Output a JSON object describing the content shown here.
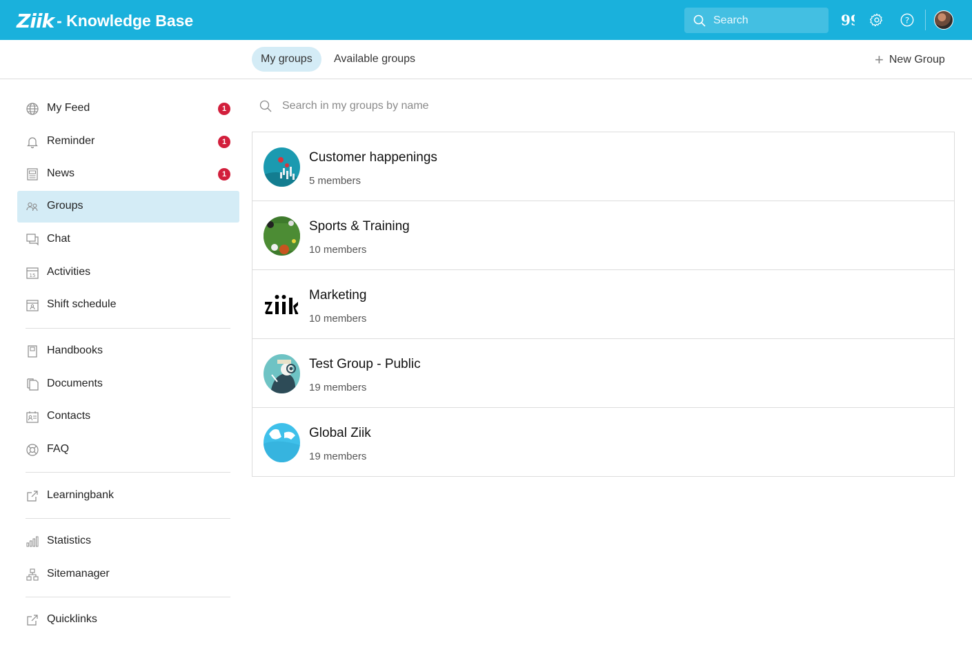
{
  "header": {
    "logo": "Ziik",
    "title": "- Knowledge Base",
    "search_placeholder": "Search",
    "icons": [
      "quote-icon",
      "gear-icon",
      "help-icon"
    ],
    "colors": {
      "topbar": "#1ab1dc",
      "active_bg": "#d4ecf6",
      "badge": "#d21f3c"
    }
  },
  "tabs": [
    {
      "label": "My groups",
      "active": true
    },
    {
      "label": "Available groups",
      "active": false
    }
  ],
  "new_group_label": "New Group",
  "sidebar": {
    "items": [
      {
        "label": "My Feed",
        "badge": "1",
        "icon": "globe-icon"
      },
      {
        "label": "Reminder",
        "badge": "1",
        "icon": "bell-icon"
      },
      {
        "label": "News",
        "badge": "1",
        "icon": "newspaper-icon"
      },
      {
        "label": "Groups",
        "active": true,
        "icon": "users-icon"
      },
      {
        "label": "Chat",
        "icon": "chat-icon"
      },
      {
        "label": "Activities",
        "icon": "calendar-icon"
      },
      {
        "label": "Shift schedule",
        "icon": "schedule-icon"
      },
      {
        "label": "Handbooks",
        "icon": "book-icon"
      },
      {
        "label": "Documents",
        "icon": "documents-icon"
      },
      {
        "label": "Contacts",
        "icon": "contacts-icon"
      },
      {
        "label": "FAQ",
        "icon": "lifebuoy-icon"
      },
      {
        "label": "Learningbank",
        "icon": "external-link-icon"
      },
      {
        "label": "Statistics",
        "icon": "bar-chart-icon"
      },
      {
        "label": "Sitemanager",
        "icon": "sitemap-icon"
      },
      {
        "label": "Quicklinks",
        "icon": "external-link-icon"
      }
    ]
  },
  "group_search_placeholder": "Search in my groups by name",
  "groups": [
    {
      "name": "Customer happenings",
      "members": "5 members"
    },
    {
      "name": "Sports & Training",
      "members": "10 members"
    },
    {
      "name": "Marketing",
      "members": "10 members"
    },
    {
      "name": "Test Group - Public",
      "members": "19 members"
    },
    {
      "name": "Global Ziik",
      "members": "19 members"
    }
  ]
}
